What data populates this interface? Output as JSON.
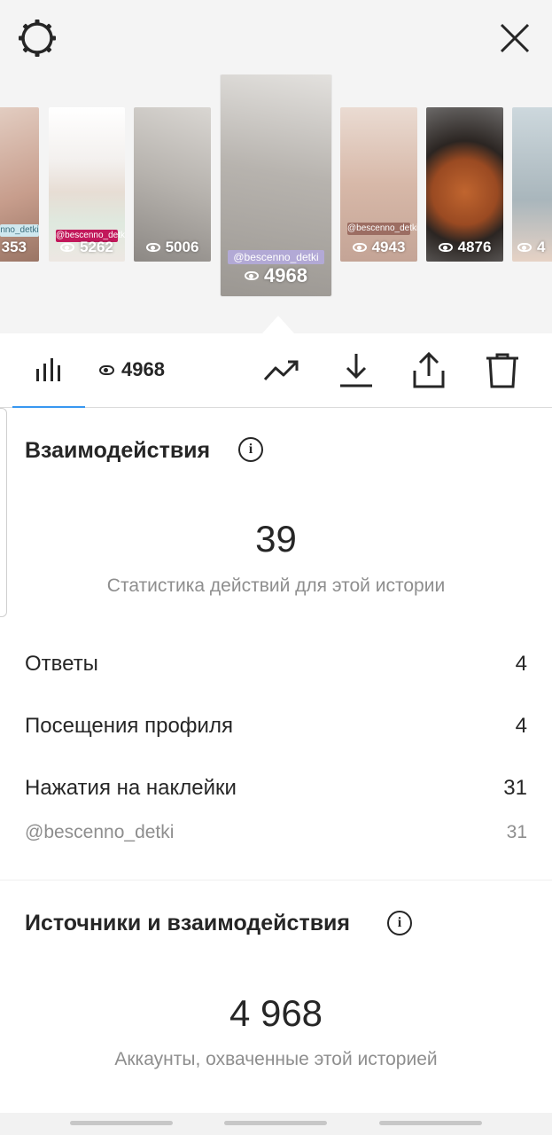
{
  "header": {
    "settings_icon": "gear-icon",
    "close_icon": "close-icon"
  },
  "stories": [
    {
      "views": "353",
      "tag": "nno_detki",
      "bg": "#d8c0b4"
    },
    {
      "views": "5262",
      "tag": "@bescenno_detki",
      "bg": "#e8e4e0"
    },
    {
      "views": "5006",
      "tag": "",
      "bg": "#b9b5b0"
    },
    {
      "views": "4968",
      "tag": "@bescenno_detki",
      "bg": "#a8a49f",
      "selected": true
    },
    {
      "views": "4943",
      "tag": "@bescenno_detki",
      "bg": "#c9a99a"
    },
    {
      "views": "4876",
      "tag": "",
      "bg": "#8f5a3b"
    },
    {
      "views": "4",
      "tag": "",
      "bg": "#b7c2c8"
    }
  ],
  "actionbar": {
    "views": "4968",
    "icons": [
      "bar-chart-icon",
      "trending-icon",
      "download-icon",
      "share-icon",
      "trash-icon"
    ]
  },
  "interactions": {
    "title": "Взаимодействия",
    "total": "39",
    "caption": "Статистика действий для этой истории",
    "rows": [
      {
        "label": "Ответы",
        "value": "4"
      },
      {
        "label": "Посещения профиля",
        "value": "4"
      },
      {
        "label": "Нажатия на наклейки",
        "value": "31"
      }
    ],
    "sub": {
      "label": "@bescenno_detki",
      "value": "31"
    }
  },
  "sources": {
    "title": "Источники и взаимодействия",
    "total": "4 968",
    "caption": "Аккаунты, охваченные этой историей"
  },
  "colors": {
    "accent": "#3897f0",
    "text": "#262626",
    "muted": "#8e8e8e"
  }
}
